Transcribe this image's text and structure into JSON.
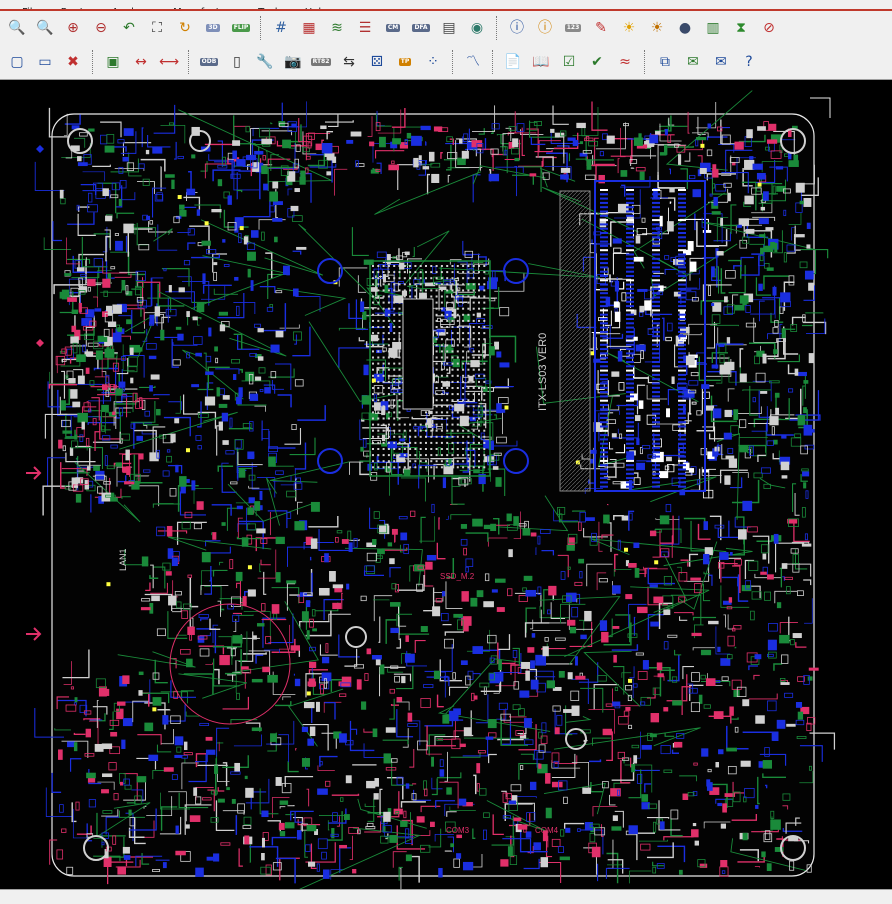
{
  "menus": [
    "File",
    "Route",
    "Analyze",
    "Manufacture",
    "Tools",
    "Help"
  ],
  "toolbar1": [
    {
      "icon": "zoom-fit-icon",
      "glyph": "🔍",
      "color": "#1e4a9a"
    },
    {
      "icon": "zoom-window-icon",
      "glyph": "🔍",
      "color": "#b03030"
    },
    {
      "icon": "zoom-in-icon",
      "glyph": "⊕",
      "color": "#b03030"
    },
    {
      "icon": "zoom-out-icon",
      "glyph": "⊖",
      "color": "#b03030"
    },
    {
      "icon": "zoom-previous-icon",
      "glyph": "↶",
      "color": "#2d7a2d"
    },
    {
      "icon": "zoom-world-icon",
      "glyph": "⛶",
      "color": "#333"
    },
    {
      "icon": "redraw-icon",
      "glyph": "↻",
      "color": "#d08000"
    },
    {
      "icon": "view-3d-icon",
      "text": "3D",
      "bg": "#7e8fb8"
    },
    {
      "icon": "flip-board-icon",
      "text": "FLIP",
      "bg": "#4a9a4a"
    },
    {
      "sep": true
    },
    {
      "icon": "grid-icon",
      "glyph": "#",
      "color": "#3060a0"
    },
    {
      "icon": "color-dialog-icon",
      "glyph": "▦",
      "color": "#b83030"
    },
    {
      "icon": "layer-visibility-icon",
      "glyph": "≋",
      "color": "#2d7a2d"
    },
    {
      "icon": "layers-icon",
      "glyph": "☰",
      "color": "#b03030"
    },
    {
      "icon": "constraint-manager-icon",
      "text": "CM",
      "bg": "#5a6a8a"
    },
    {
      "icon": "dfa-icon",
      "text": "DFA",
      "bg": "#5a6a8a"
    },
    {
      "icon": "spreadsheet-icon",
      "glyph": "▤",
      "color": "#444"
    },
    {
      "icon": "globe-icon",
      "glyph": "◉",
      "color": "#2d7a6a"
    },
    {
      "sep": true
    },
    {
      "icon": "info-icon",
      "glyph": "ⓘ",
      "color": "#1e4a9a"
    },
    {
      "icon": "show-element-icon",
      "glyph": "ⓘ",
      "color": "#d08000"
    },
    {
      "icon": "measure-icon",
      "text": "123",
      "bg": "#8a8a8a"
    },
    {
      "icon": "pencil-icon",
      "glyph": "✎",
      "color": "#c03030"
    },
    {
      "icon": "highlight-icon",
      "glyph": "☀",
      "color": "#e0a000"
    },
    {
      "icon": "dehighlight-icon",
      "glyph": "☀",
      "color": "#c07000"
    },
    {
      "icon": "bomb-icon",
      "glyph": "●",
      "color": "#3a4a6a"
    },
    {
      "icon": "barcode-icon",
      "glyph": "▥",
      "color": "#2d7a2d"
    },
    {
      "icon": "hourglass-icon",
      "glyph": "⧗",
      "color": "#2d8a2d"
    },
    {
      "icon": "no-select-icon",
      "glyph": "⊘",
      "color": "#c03030"
    }
  ],
  "toolbar2": [
    {
      "icon": "rectangle-select-icon",
      "glyph": "▢",
      "color": "#1e4a9a"
    },
    {
      "icon": "window-icon",
      "glyph": "▭",
      "color": "#1e4a9a"
    },
    {
      "icon": "delete-icon",
      "glyph": "✖",
      "color": "#c03030"
    },
    {
      "sep": true
    },
    {
      "icon": "component-icon",
      "glyph": "▣",
      "color": "#2d7a2d"
    },
    {
      "icon": "dimension-icon",
      "glyph": "↔",
      "color": "#c03030"
    },
    {
      "icon": "horizontal-dim-icon",
      "glyph": "⟷",
      "color": "#c03030"
    },
    {
      "sep": true
    },
    {
      "icon": "odb-icon",
      "text": "ODB",
      "bg": "#5a6a8a"
    },
    {
      "icon": "padstack-icon",
      "glyph": "▯",
      "color": "#333"
    },
    {
      "icon": "tool-icon",
      "glyph": "🔧",
      "color": "#555"
    },
    {
      "icon": "camera-icon",
      "glyph": "📷",
      "color": "#333"
    },
    {
      "icon": "refdes-icon",
      "text": "RT82",
      "bg": "#777"
    },
    {
      "icon": "connect-icon",
      "glyph": "⇆",
      "color": "#333"
    },
    {
      "icon": "dice-icon",
      "glyph": "⚄",
      "color": "#1e4a9a"
    },
    {
      "icon": "testprep-icon",
      "text": "TP",
      "bg": "#d08000"
    },
    {
      "icon": "array-icon",
      "glyph": "⁘",
      "color": "#1e4a9a"
    },
    {
      "sep": true
    },
    {
      "icon": "route-icon",
      "glyph": "〽",
      "color": "#1e4a9a"
    },
    {
      "sep": true
    },
    {
      "icon": "report-icon",
      "glyph": "📄",
      "color": "#333"
    },
    {
      "icon": "book-icon",
      "glyph": "📖",
      "color": "#1e4a9a"
    },
    {
      "icon": "checklist-icon",
      "glyph": "☑",
      "color": "#2d7a2d"
    },
    {
      "icon": "check-icon",
      "glyph": "✔",
      "color": "#2d7a2d"
    },
    {
      "icon": "wave-icon",
      "glyph": "≈",
      "color": "#c03030"
    },
    {
      "sep": true
    },
    {
      "icon": "copy-icon",
      "glyph": "⧉",
      "color": "#1e4a9a"
    },
    {
      "icon": "mail-icon",
      "glyph": "✉",
      "color": "#2d7a2d"
    },
    {
      "icon": "envelope-icon",
      "glyph": "✉",
      "color": "#1e4a9a"
    },
    {
      "icon": "help-icon",
      "glyph": "?",
      "color": "#1e4a9a"
    }
  ],
  "board": {
    "colors": {
      "blue": "#1a2ee0",
      "red": "#e0306a",
      "green": "#1a8a3a",
      "grey": "#d0d0d0",
      "white": "#ffffff",
      "yellow": "#ffff40"
    },
    "silk": {
      "vertical": "ITX-LS03 VER0",
      "lan": "LAN1",
      "ssd": "SSD_M.2",
      "com": [
        "COM3",
        "COM4"
      ]
    }
  }
}
